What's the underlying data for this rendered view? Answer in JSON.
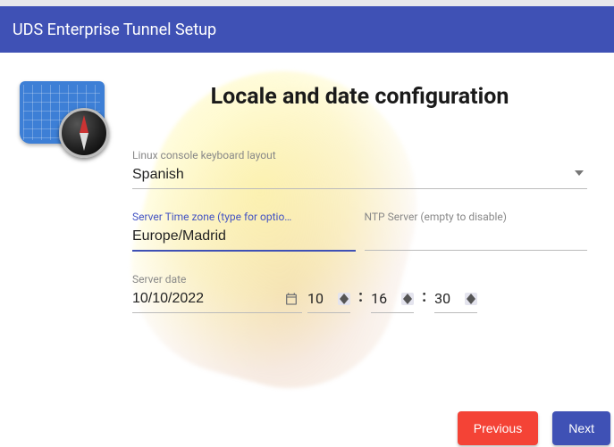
{
  "header": {
    "title": "UDS Enterprise Tunnel Setup"
  },
  "page_title": "Locale and date configuration",
  "keyboard": {
    "label": "Linux console keyboard layout",
    "value": "Spanish"
  },
  "timezone": {
    "label": "Server Time zone (type for optio…",
    "value": "Europe/Madrid"
  },
  "ntp": {
    "label": "NTP Server (empty to disable)",
    "value": ""
  },
  "server_date": {
    "label": "Server date",
    "date": "10/10/2022",
    "hour": "10",
    "minute": "16",
    "second": "30"
  },
  "buttons": {
    "previous": "Previous",
    "next": "Next"
  }
}
